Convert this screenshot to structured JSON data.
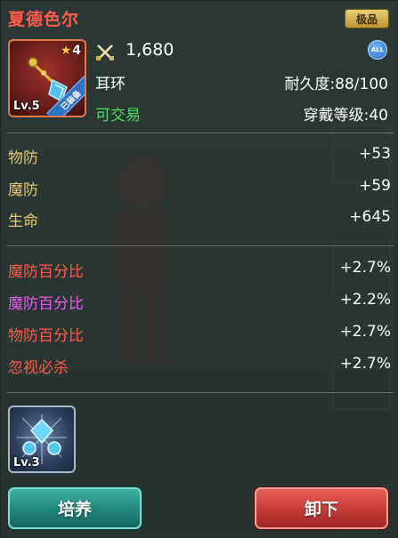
{
  "header": {
    "item_name": "夏德色尔",
    "quality_badge": "极品"
  },
  "item": {
    "stars": "4",
    "level": "Lv.5",
    "equipped_tag": "已装备",
    "power": "1,680",
    "all_badge": "ALL",
    "type": "耳环",
    "durability": "耐久度:88/100",
    "trade_status": "可交易",
    "wear_level": "穿戴等级:40",
    "icon": "earring-icon"
  },
  "base_stats": [
    {
      "name": "物防",
      "value": "+53"
    },
    {
      "name": "魔防",
      "value": "+59"
    },
    {
      "name": "生命",
      "value": "+645"
    }
  ],
  "extra_stats": [
    {
      "name": "魔防百分比",
      "value": "+2.7%",
      "color": "#ff5a4a"
    },
    {
      "name": "魔防百分比",
      "value": "+2.2%",
      "color": "#e85cf0"
    },
    {
      "name": "物防百分比",
      "value": "+2.7%",
      "color": "#ff5a4a"
    },
    {
      "name": "忽视必杀",
      "value": "+2.7%",
      "color": "#ff5a4a"
    }
  ],
  "gem": {
    "level": "Lv.3",
    "icon": "gem-icon"
  },
  "buttons": {
    "cultivate": "培养",
    "unequip": "卸下"
  },
  "colors": {
    "title": "#ff5a4a",
    "base_stat_name": "#e8c86a",
    "tradable": "#4fdc60",
    "button_teal": "#23857d",
    "button_red": "#c53b37"
  }
}
